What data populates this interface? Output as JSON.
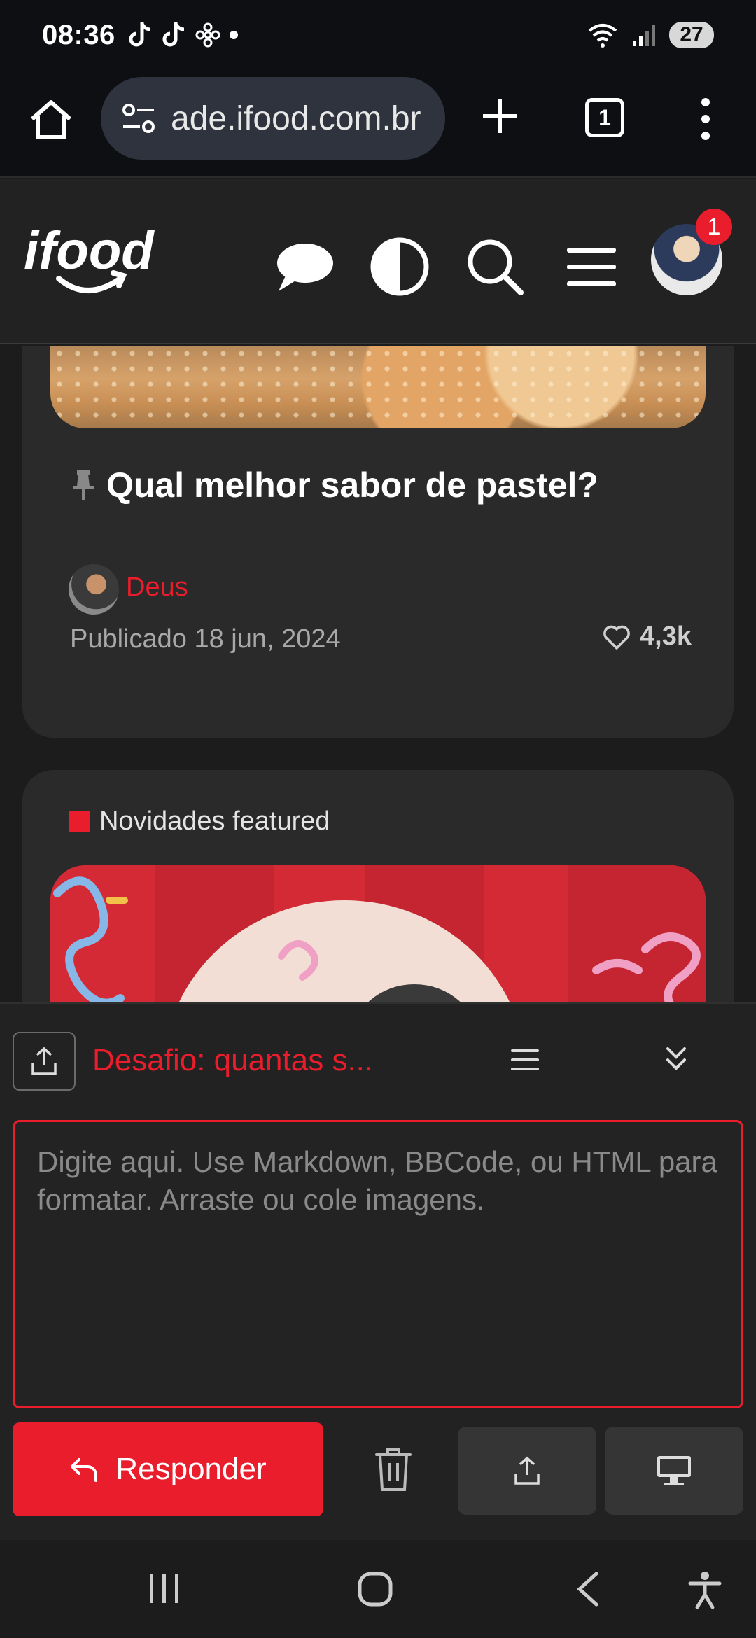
{
  "status_bar": {
    "time": "08:36",
    "battery": "27"
  },
  "browser": {
    "url": "ade.ifood.com.br",
    "tab_count": "1"
  },
  "site": {
    "notification_count": "1"
  },
  "post": {
    "title": "Qual melhor sabor de pastel?",
    "author": "Deus",
    "published": "Publicado 18 jun, 2024",
    "likes": "4,3k"
  },
  "next_card": {
    "category": "Novidades featured"
  },
  "composer": {
    "topic_title": "Desafio: quantas s...",
    "placeholder": "Digite aqui. Use Markdown, BBCode, ou HTML para formatar. Arraste ou cole imagens.",
    "reply_button": "Responder"
  },
  "colors": {
    "brand_red": "#ea1d2c",
    "background": "#1c1c1c",
    "card": "#2a2a2a"
  }
}
